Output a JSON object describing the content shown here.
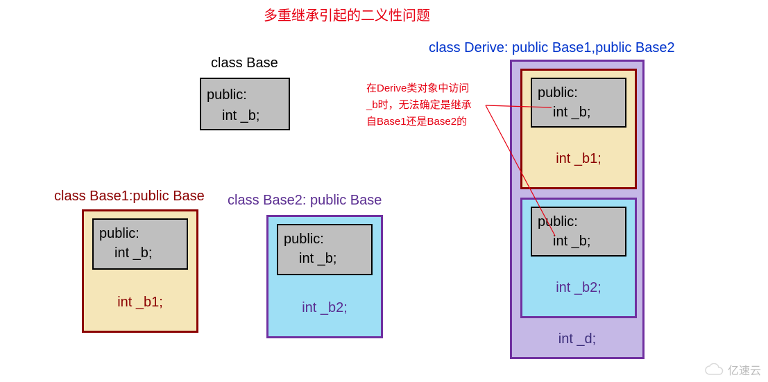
{
  "title": "多重继承引起的二义性问题",
  "labels": {
    "base": "class Base",
    "base1": "class Base1:public Base",
    "base2": "class Base2: public Base",
    "derive": "class Derive: public Base1,public Base2"
  },
  "note": {
    "line1": "在Derive类对象中访问",
    "line2": "_b时，无法确定是继承",
    "line3": "自Base1还是Base2的"
  },
  "base": {
    "access": "public:",
    "member": "int _b;"
  },
  "base1": {
    "inner_access": "public:",
    "inner_member": "int _b;",
    "own_member": "int _b1;"
  },
  "base2": {
    "inner_access": "public:",
    "inner_member": "int _b;",
    "own_member": "int _b2;"
  },
  "derive": {
    "base1_block": {
      "inner_access": "public:",
      "inner_member": "int _b;",
      "own_member": "int _b1;"
    },
    "base2_block": {
      "inner_access": "public:",
      "inner_member": "int _b;",
      "own_member": "int _b2;"
    },
    "own_member": "int _d;"
  },
  "watermark": "亿速云"
}
